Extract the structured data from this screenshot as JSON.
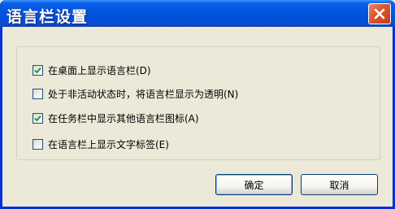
{
  "window": {
    "title": "语言栏设置"
  },
  "options": [
    {
      "label": "在桌面上显示语言栏(D)",
      "checked": true
    },
    {
      "label": "处于非活动状态时，将语言栏显示为透明(N)",
      "checked": false
    },
    {
      "label": "在任务栏中显示其他语言栏图标(A)",
      "checked": true
    },
    {
      "label": "在语言栏上显示文字标签(E)",
      "checked": false
    }
  ],
  "buttons": {
    "ok_label": "确定",
    "cancel_label": "取消"
  },
  "icons": {
    "close": "close-icon",
    "check": "check-icon"
  },
  "colors": {
    "titlebar": "#0454E0",
    "close": "#DA5A33",
    "face": "#ECE9D8",
    "check": "#21A121"
  }
}
